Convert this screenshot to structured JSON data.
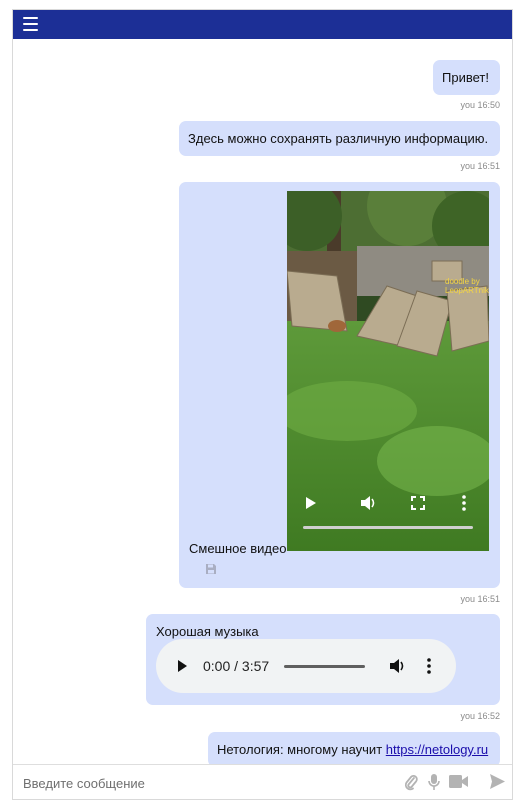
{
  "messages": [
    {
      "text": "Привет!",
      "author": "you",
      "time": "16:50"
    },
    {
      "text": "Здесь можно сохранять различную информацию.",
      "author": "you",
      "time": "16:51"
    },
    {
      "caption": "Смешное видео",
      "author": "you",
      "time": "16:51",
      "video_watermark": "doodle by\nLeopARTnik"
    },
    {
      "text": "Хорошая музыка",
      "author": "you",
      "time": "16:52",
      "audio": {
        "current": "0:00",
        "duration": "3:57",
        "display": "0:00 / 3:57"
      }
    },
    {
      "text": "Нетология: многому научит ",
      "link": "https://netology.ru"
    }
  ],
  "composer": {
    "placeholder": "Введите сообщение",
    "value": ""
  },
  "icons": {
    "menu": "hamburger-menu-icon",
    "save": "floppy-disk-icon",
    "attach": "paperclip-icon",
    "mic": "microphone-icon",
    "camera": "video-camera-icon",
    "send": "send-arrow-icon",
    "play": "play-icon",
    "volume": "volume-icon",
    "fullscreen": "fullscreen-icon",
    "more": "more-vertical-icon"
  },
  "colors": {
    "header": "#1c2f96",
    "bubble": "#d5dffc",
    "link": "#1a0dab"
  }
}
